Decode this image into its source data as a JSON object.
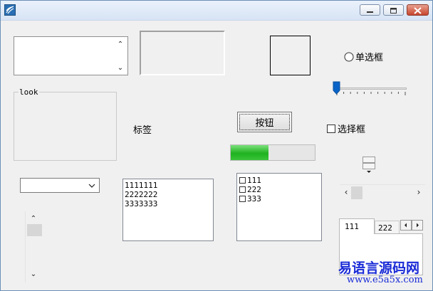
{
  "window": {
    "title": "",
    "controls": [
      "minimize-icon",
      "maximize-icon",
      "close-icon"
    ]
  },
  "controls": {
    "radio_label": "单选框",
    "static_label": "标签",
    "button_label": "按钮",
    "checkbox_label": "选择框",
    "groupbox_label": "look",
    "progress_percent": 45,
    "slider_value_fraction": 0.0,
    "listbox_items": [
      "1111111",
      "2222222",
      "3333333"
    ],
    "checklist_items": [
      "111",
      "222",
      "333"
    ],
    "tabs": [
      "111",
      "222"
    ],
    "combo_value": ""
  },
  "watermark": {
    "line1": "易语言源码网",
    "line2": "www.e5a5x.com"
  },
  "colors": {
    "progress_fill": "#1fb21f",
    "slider_thumb": "#0a64c8",
    "watermark": "#1a2bd6"
  }
}
